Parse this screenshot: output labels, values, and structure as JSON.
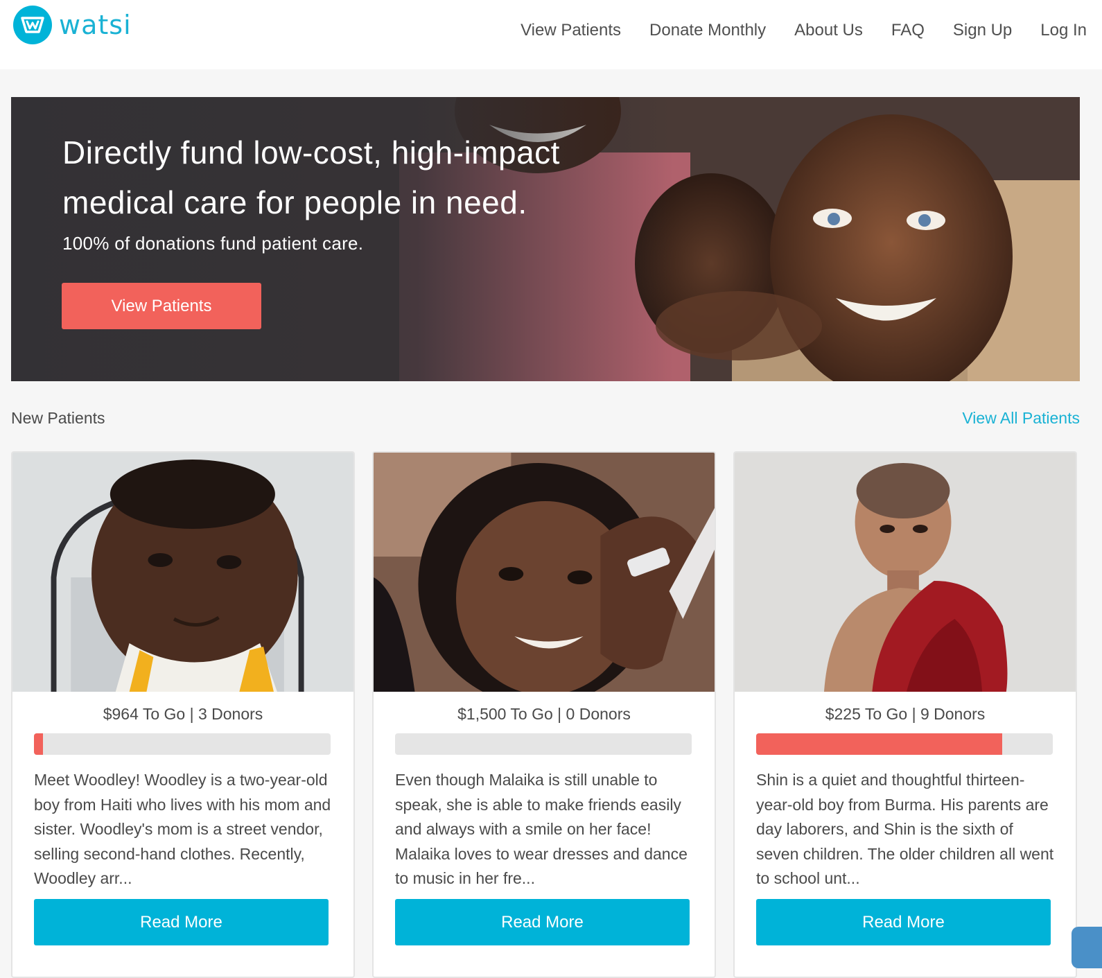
{
  "brand": {
    "name": "watsi",
    "logo_icon": "watsi-w-logo-icon",
    "primary_color": "#00b3d8",
    "accent_color": "#f2625b"
  },
  "nav": {
    "items": [
      {
        "label": "View Patients"
      },
      {
        "label": "Donate Monthly"
      },
      {
        "label": "About Us"
      },
      {
        "label": "FAQ"
      },
      {
        "label": "Sign Up"
      },
      {
        "label": "Log In"
      }
    ]
  },
  "hero": {
    "title": "Directly fund low-cost, high-impact medical care for people in need.",
    "subtitle": "100% of donations fund patient care.",
    "cta_label": "View Patients"
  },
  "patients_section": {
    "title": "New Patients",
    "view_all_label": "View All Patients",
    "patients": [
      {
        "stats": "$964 To Go | 3 Donors",
        "progress": 0.03,
        "description": "Meet Woodley! Woodley is a two-year-old boy from Haiti who lives with his mom and sister. Woodley's mom is a street vendor, selling second-hand clothes. Recently, Woodley arr...",
        "button_label": "Read More"
      },
      {
        "stats": "$1,500 To Go | 0 Donors",
        "progress": 0,
        "description": "Even though Malaika is still unable to speak, she is able to make friends easily and always with a smile on her face! Malaika loves to wear dresses and dance to music in her fre...",
        "button_label": "Read More"
      },
      {
        "stats": "$225 To Go | 9 Donors",
        "progress": 0.83,
        "description": "Shin is a quiet and thoughtful thirteen-year-old boy from Burma. His parents are day laborers, and Shin is the sixth of seven children. The older children all went to school unt...",
        "button_label": "Read More"
      }
    ]
  }
}
